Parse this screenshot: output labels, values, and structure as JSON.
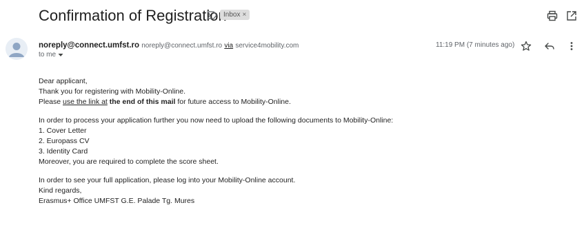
{
  "email": {
    "subject": "Confirmation of Registration",
    "label": "Inbox",
    "label_close": "×",
    "sender": {
      "name": "noreply@connect.umfst.ro",
      "email": "noreply@connect.umfst.ro",
      "via_label": "via",
      "via_domain": "service4mobility.com"
    },
    "to_label": "to me",
    "timestamp": "11:19 PM (7 minutes ago)",
    "body": {
      "greeting": "Dear applicant,",
      "thanks": "Thank you for registering with Mobility-Online.",
      "access_prefix": "Please ",
      "access_link": "use the link at",
      "access_bold": " the end of this mail",
      "access_suffix": " for future access to Mobility-Online.",
      "process": "In order to process your application further you now need to upload the following documents to Mobility-Online:",
      "documents": [
        "1. Cover Letter",
        "2. Europass CV",
        "3. Identity Card"
      ],
      "score": "Moreover, you are required to complete the score sheet.",
      "login": "In order to see your full application, please log into your Mobility-Online account.",
      "regards": "Kind regards,",
      "signature": "Erasmus+ Office UMFST G.E. Palade Tg. Mures"
    }
  },
  "icons": {
    "importance": "importance-marker-icon",
    "print": "print-icon",
    "new_window": "open-in-new-window-icon",
    "star": "star-icon",
    "reply": "reply-icon",
    "more": "more-vert-icon",
    "to_dropdown": "caret-down-icon",
    "avatar": "default-avatar-icon"
  },
  "colors": {
    "label_bg": "#dddddd",
    "secondary_text": "#5f6368",
    "icon": "#444746",
    "avatar_fg": "#8fa6c4"
  }
}
